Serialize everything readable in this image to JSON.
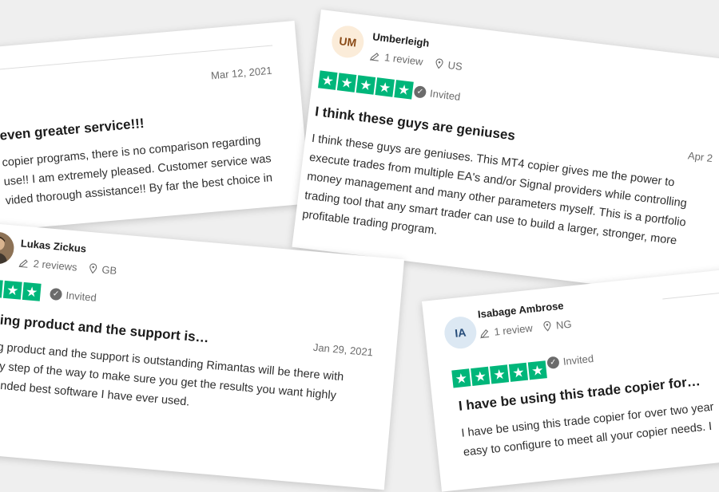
{
  "reviews": [
    {
      "reviewer": "",
      "date": "Mar 12, 2021",
      "title": "even greater service!!!",
      "body": [
        "copier programs, there is no comparison regarding",
        "use!! I am extremely pleased. Customer service was",
        "vided thorough assistance!! By far the best choice in"
      ]
    },
    {
      "reviewer": "Umberleigh",
      "initials": "UM",
      "review_count": "1 review",
      "country": "US",
      "status": "Invited",
      "date": "Apr 2",
      "title": "I think these guys are geniuses",
      "body": [
        "I think these guys are geniuses. This MT4 copier gives me the power to",
        "execute trades from multiple EA's and/or Signal providers while controlling",
        "money management and many other parameters myself. This is a portfolio",
        "trading tool that any smart trader can use to build a larger, stronger, more",
        "profitable trading program."
      ]
    },
    {
      "reviewer": "Lukas Zickus",
      "review_count": "2 reviews",
      "country": "GB",
      "status": "Invited",
      "date": "Jan 29, 2021",
      "title": "zing product and the support is…",
      "body": [
        "ng product and the support is outstanding Rimantas will be there with",
        "ery step of the way to make sure you get the results you want highly",
        "nended best software I have ever used."
      ]
    },
    {
      "reviewer": "Isabage Ambrose",
      "initials": "IA",
      "review_count": "1 review",
      "country": "NG",
      "status": "Invited",
      "title": "I have be using this trade copier for…",
      "body": [
        "I have be using this trade copier for over two year",
        "easy to configure to meet all your copier needs. I"
      ]
    }
  ],
  "colors": {
    "star_green": "#00b67a",
    "text": "#1c1c1c",
    "muted": "#6b6b6b"
  },
  "icons": [
    "pencil-icon",
    "location-pin-icon",
    "check-circle-icon",
    "star-icon"
  ]
}
